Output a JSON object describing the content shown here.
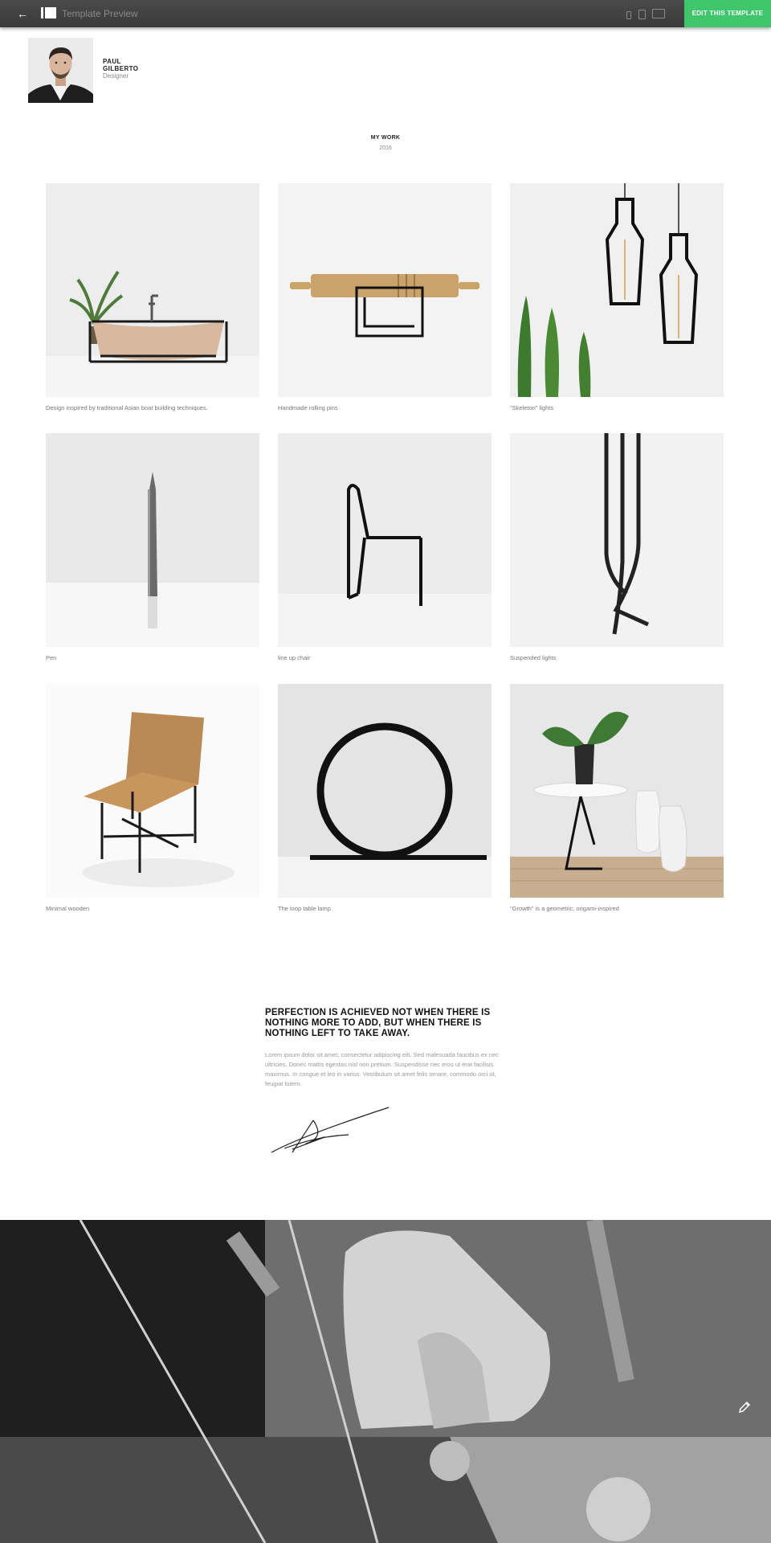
{
  "topbar": {
    "title": "Template Preview",
    "edit_label": "EDIT THIS TEMPLATE",
    "back_icon": "arrow-left-icon",
    "logo_icon": "editor-logo-icon",
    "devices": [
      "mobile-icon",
      "tablet-icon",
      "desktop-icon"
    ],
    "accent": "#3fc56b"
  },
  "profile": {
    "first_name": "PAUL",
    "last_name": "GILBERTO",
    "role": "Designer"
  },
  "work": {
    "title": "MY WORK",
    "year": "2016",
    "items": [
      {
        "caption": "Design inspired by traditional Asian boat building techniques."
      },
      {
        "caption": "Handmade rolling pins"
      },
      {
        "caption": "\"Skeleton\" lights"
      },
      {
        "caption": "Pen"
      },
      {
        "caption": "line up chair"
      },
      {
        "caption": "Suspended lights"
      },
      {
        "caption": "Minimal wooden"
      },
      {
        "caption": "The loop table lamp"
      },
      {
        "caption": "\"Growth\" is a geometric, origami-inspired"
      }
    ]
  },
  "quote": {
    "text": "PERFECTION IS ACHIEVED NOT WHEN THERE IS NOTHING MORE TO ADD, BUT WHEN THERE IS NOTHING LEFT TO TAKE AWAY.",
    "body": "Lorem ipsum dolor sit amet, consectetur adipiscing elit. Sed malesuada faucibus ex nec ultricies. Donec mattis egestas nisl non pretium. Suspendisse nec eros ut erat facilisis maximus. In congue et leo in varius. Vestibulum sit amet felis ornare, commodo orci ut, feugiat lorem."
  },
  "banner": {
    "edit_icon": "pencil-icon"
  }
}
